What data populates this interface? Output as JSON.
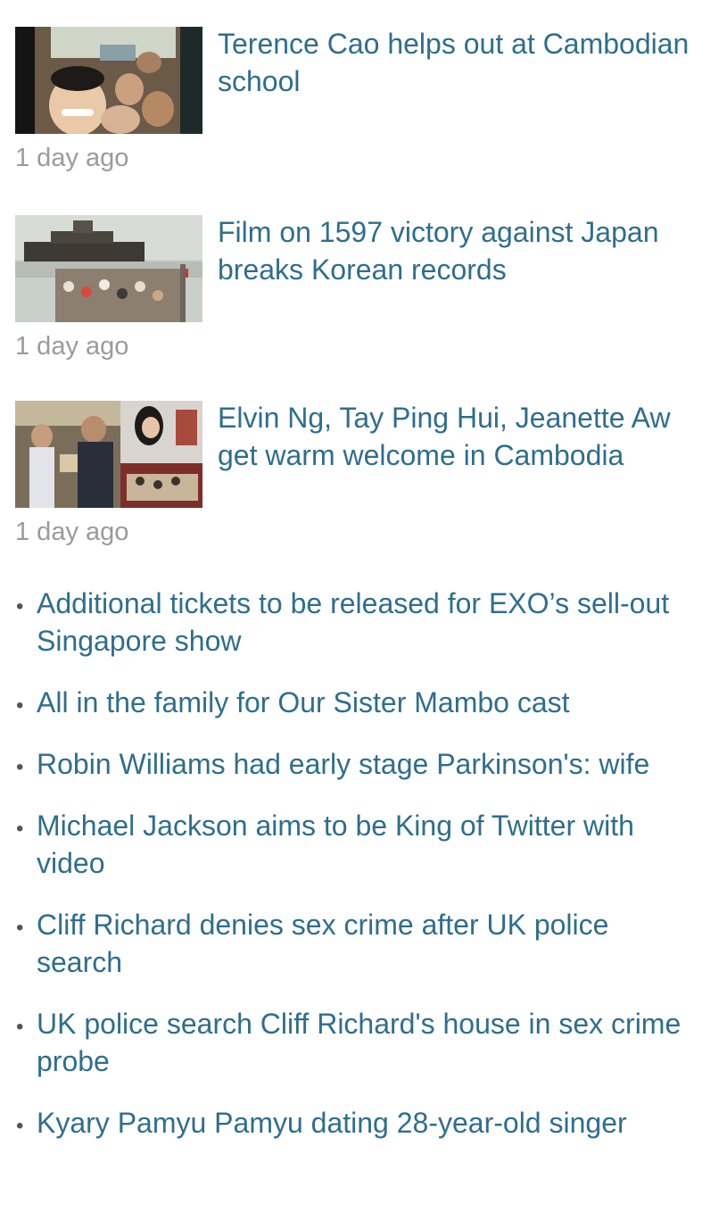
{
  "featured": [
    {
      "headline": "Terence Cao helps out at Cambodian school",
      "time": "1 day ago",
      "thumbnail": "group-selfie-photo"
    },
    {
      "headline": "Film on 1597 victory against Japan breaks Korean records",
      "time": "1 day ago",
      "thumbnail": "warship-harbor-photo"
    },
    {
      "headline": "Elvin Ng, Tay Ping Hui, Jeanette Aw get warm welcome in Cambodia",
      "time": "1 day ago",
      "thumbnail": "crowd-collage-photo"
    }
  ],
  "list": [
    "Additional tickets to be released for EXO’s sell-out Singapore show",
    "All in the family for Our Sister Mambo cast",
    "Robin Williams had early stage Parkinson's: wife",
    "Michael Jackson aims to be King of Twitter with video",
    "Cliff Richard denies sex crime after UK police search",
    "UK police search Cliff Richard's house in sex crime probe",
    "Kyary Pamyu Pamyu dating 28-year-old singer"
  ],
  "bullet_glyph": "•",
  "colors": {
    "link": "#2f6e8c",
    "timestamp": "#9b9b9b"
  }
}
